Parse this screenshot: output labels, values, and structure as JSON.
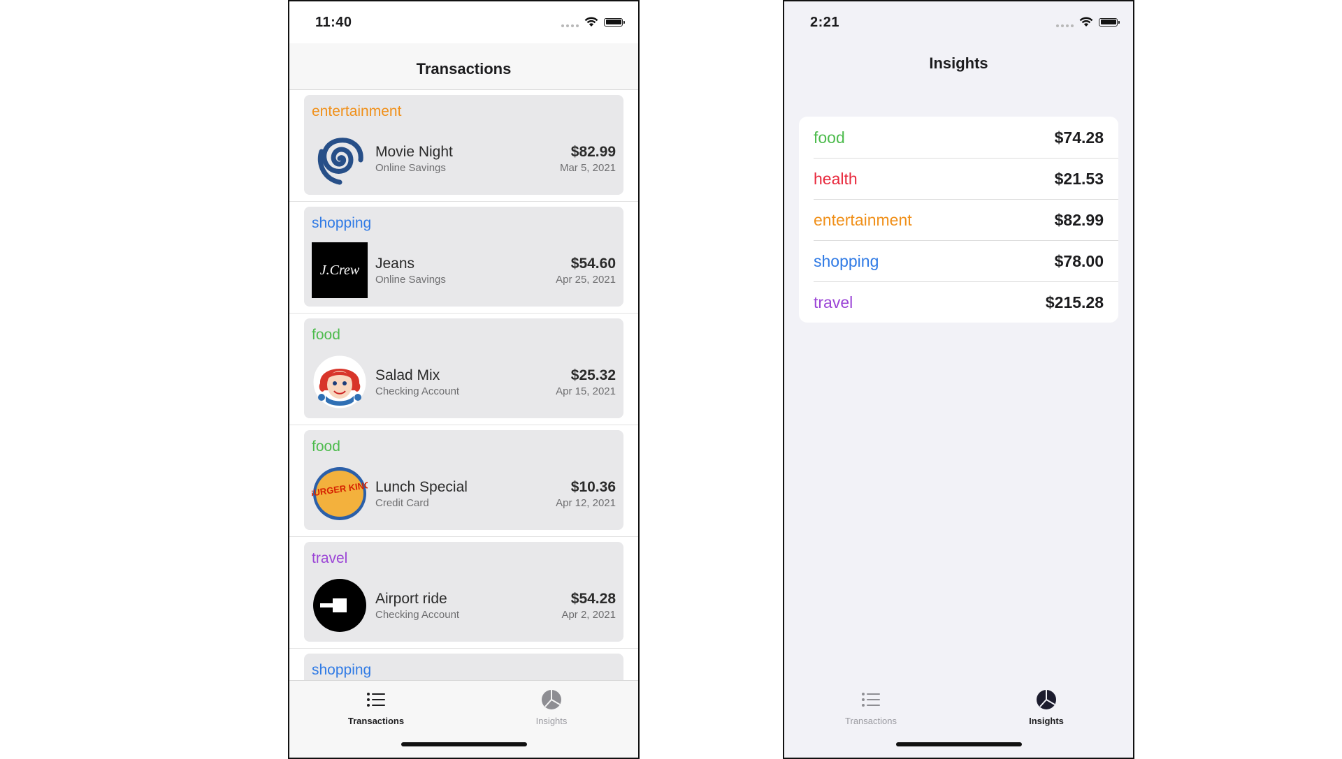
{
  "colors": {
    "entertainment": "#f0901a",
    "shopping": "#2f7ae5",
    "food": "#4cbb4c",
    "health": "#e8283c",
    "travel": "#9b45d6"
  },
  "left_screen": {
    "status_time": "11:40",
    "nav_title": "Transactions",
    "transactions": [
      {
        "category": "entertainment",
        "name": "Movie Night",
        "account": "Online Savings",
        "amount": "$82.99",
        "date": "Mar 5, 2021",
        "logo": "spiral-logo-icon"
      },
      {
        "category": "shopping",
        "name": "Jeans",
        "account": "Online Savings",
        "amount": "$54.60",
        "date": "Apr 25, 2021",
        "logo": "jcrew-logo-icon",
        "logo_text": "J.Crew"
      },
      {
        "category": "food",
        "name": "Salad Mix",
        "account": "Checking Account",
        "amount": "$25.32",
        "date": "Apr 15, 2021",
        "logo": "wendys-logo-icon"
      },
      {
        "category": "food",
        "name": "Lunch Special",
        "account": "Credit Card",
        "amount": "$10.36",
        "date": "Apr 12, 2021",
        "logo": "burger-king-logo-icon",
        "logo_text": "BURGER KING"
      },
      {
        "category": "travel",
        "name": "Airport ride",
        "account": "Checking Account",
        "amount": "$54.28",
        "date": "Apr 2, 2021",
        "logo": "uber-logo-icon"
      },
      {
        "category": "shopping"
      }
    ],
    "tabs": [
      {
        "label": "Transactions",
        "icon": "list-icon",
        "active": true
      },
      {
        "label": "Insights",
        "icon": "pie-chart-icon",
        "active": false
      }
    ]
  },
  "right_screen": {
    "status_time": "2:21",
    "nav_title": "Insights",
    "insights": [
      {
        "category": "food",
        "amount": "$74.28"
      },
      {
        "category": "health",
        "amount": "$21.53"
      },
      {
        "category": "entertainment",
        "amount": "$82.99"
      },
      {
        "category": "shopping",
        "amount": "$78.00"
      },
      {
        "category": "travel",
        "amount": "$215.28"
      }
    ],
    "tabs": [
      {
        "label": "Transactions",
        "icon": "list-icon",
        "active": false
      },
      {
        "label": "Insights",
        "icon": "pie-chart-icon",
        "active": true
      }
    ]
  }
}
